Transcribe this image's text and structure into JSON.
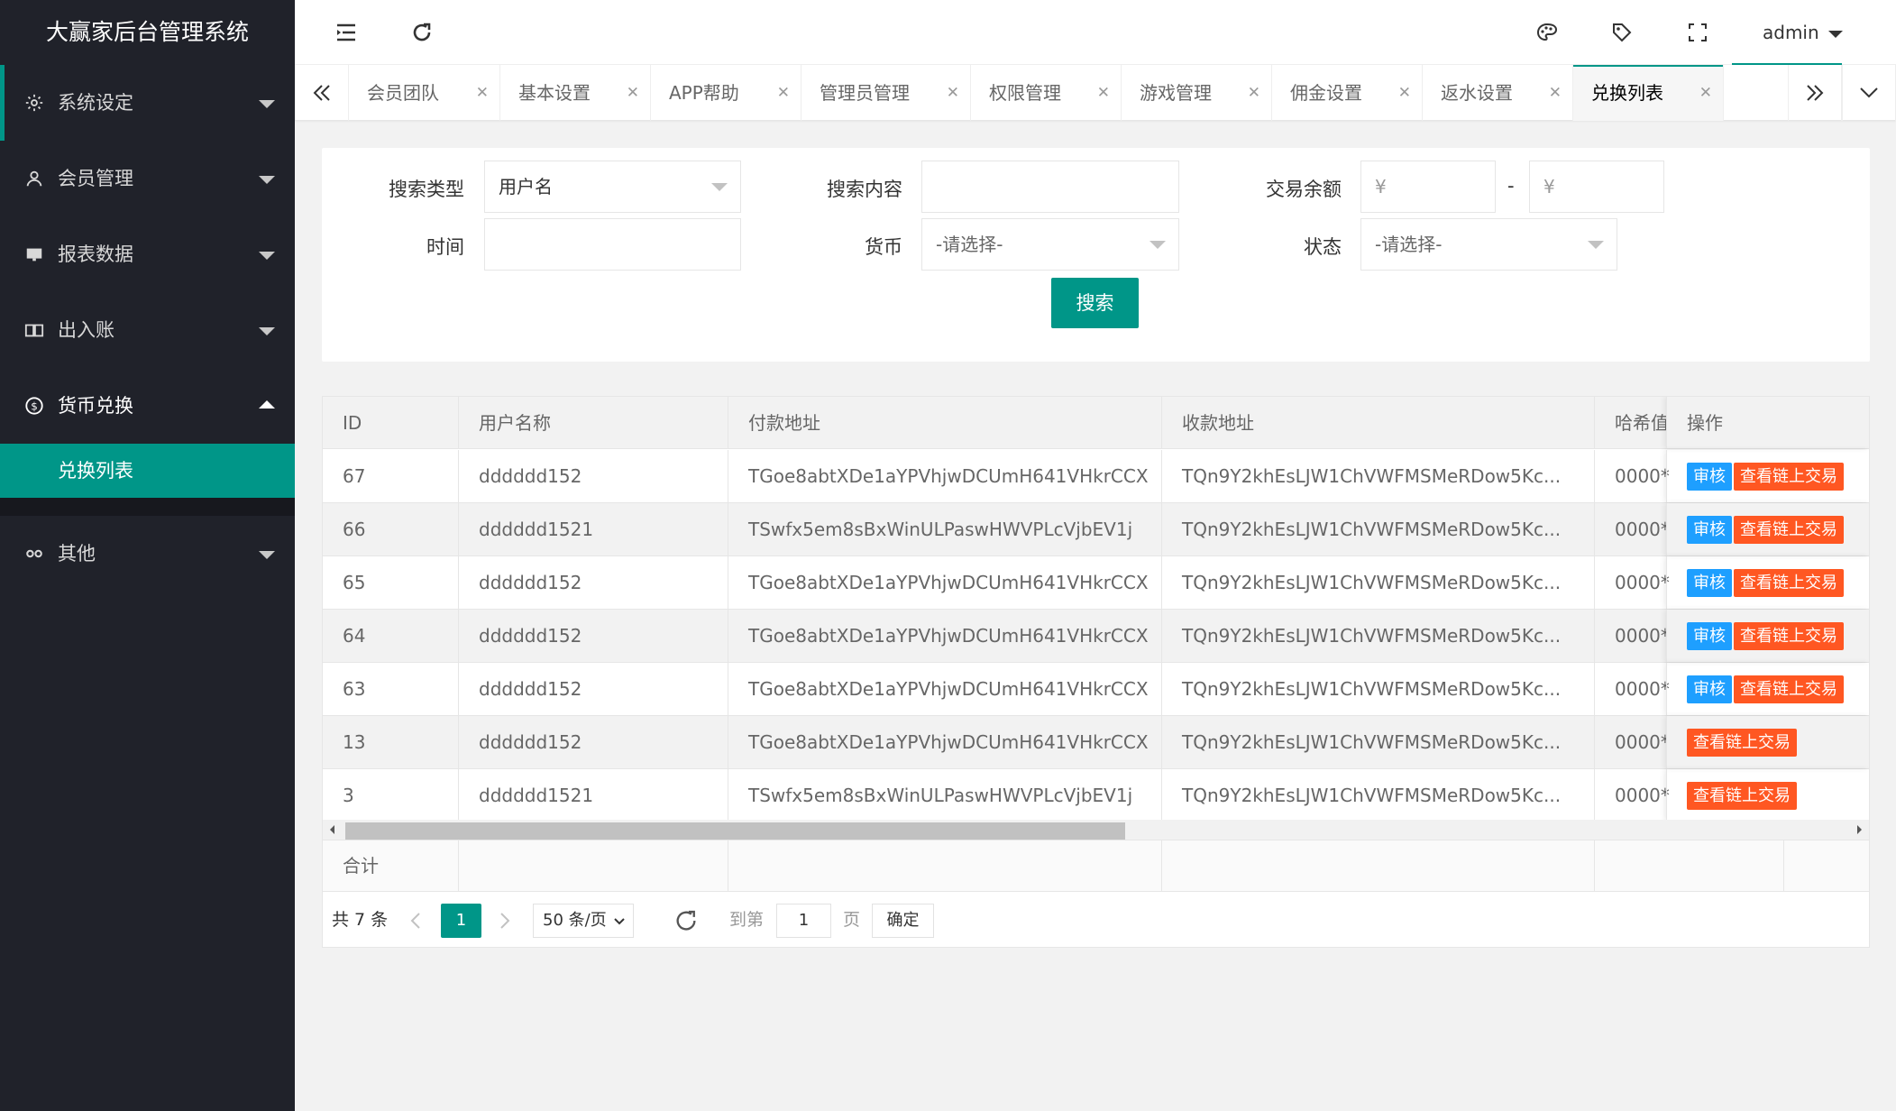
{
  "app": {
    "title": "大赢家后台管理系统"
  },
  "sidebar": {
    "items": [
      {
        "label": "系统设定"
      },
      {
        "label": "会员管理"
      },
      {
        "label": "报表数据"
      },
      {
        "label": "出入账"
      },
      {
        "label": "货币兑换"
      },
      {
        "label": "其他"
      }
    ],
    "sub_item": "兑换列表"
  },
  "header": {
    "user": "admin"
  },
  "tabs": [
    {
      "label": "会员团队"
    },
    {
      "label": "基本设置"
    },
    {
      "label": "APP帮助"
    },
    {
      "label": "管理员管理"
    },
    {
      "label": "权限管理"
    },
    {
      "label": "游戏管理"
    },
    {
      "label": "佣金设置"
    },
    {
      "label": "返水设置"
    },
    {
      "label": "兑换列表",
      "active": true
    }
  ],
  "search": {
    "type_label": "搜索类型",
    "type_value": "用户名",
    "content_label": "搜索内容",
    "content_value": "",
    "balance_label": "交易余额",
    "balance_min_placeholder": "¥",
    "balance_dash": "-",
    "balance_max_placeholder": "¥",
    "time_label": "时间",
    "time_value": "",
    "currency_label": "货币",
    "currency_placeholder": "-请选择-",
    "status_label": "状态",
    "status_placeholder": "-请选择-",
    "submit_label": "搜索"
  },
  "table": {
    "columns": [
      "ID",
      "用户名称",
      "付款地址",
      "收款地址",
      "哈希值",
      "操作"
    ],
    "rows": [
      {
        "id": "67",
        "user": "dddddd152",
        "pay": "TGoe8abtXDe1aYPVhjwDCUmH641VHkrCCX",
        "recv": "TQn9Y2khEsLJW1ChVWFMSMeRDow5Kc...",
        "hash": "0000*",
        "audit": true
      },
      {
        "id": "66",
        "user": "dddddd1521",
        "pay": "TSwfx5em8sBxWinULPaswHWVPLcVjbEV1j",
        "recv": "TQn9Y2khEsLJW1ChVWFMSMeRDow5Kc...",
        "hash": "0000*",
        "audit": true
      },
      {
        "id": "65",
        "user": "dddddd152",
        "pay": "TGoe8abtXDe1aYPVhjwDCUmH641VHkrCCX",
        "recv": "TQn9Y2khEsLJW1ChVWFMSMeRDow5Kc...",
        "hash": "0000*",
        "audit": true
      },
      {
        "id": "64",
        "user": "dddddd152",
        "pay": "TGoe8abtXDe1aYPVhjwDCUmH641VHkrCCX",
        "recv": "TQn9Y2khEsLJW1ChVWFMSMeRDow5Kc...",
        "hash": "0000*",
        "audit": true
      },
      {
        "id": "63",
        "user": "dddddd152",
        "pay": "TGoe8abtXDe1aYPVhjwDCUmH641VHkrCCX",
        "recv": "TQn9Y2khEsLJW1ChVWFMSMeRDow5Kc...",
        "hash": "0000*",
        "audit": true
      },
      {
        "id": "13",
        "user": "dddddd152",
        "pay": "TGoe8abtXDe1aYPVhjwDCUmH641VHkrCCX",
        "recv": "TQn9Y2khEsLJW1ChVWFMSMeRDow5Kc...",
        "hash": "0000*",
        "audit": false
      },
      {
        "id": "3",
        "user": "dddddd1521",
        "pay": "TSwfx5em8sBxWinULPaswHWVPLcVjbEV1j",
        "recv": "TQn9Y2khEsLJW1ChVWFMSMeRDow5Kc...",
        "hash": "0000*",
        "audit": false
      }
    ],
    "audit_label": "审核",
    "chain_label": "查看链上交易",
    "total_label": "合计"
  },
  "pager": {
    "total_text": "共 7 条",
    "current_page": "1",
    "page_size": "50 条/页",
    "goto_label": "到第",
    "goto_value": "1",
    "page_unit": "页",
    "confirm_label": "确定"
  },
  "colors": {
    "primary": "#009688",
    "blue": "#1e9fff",
    "orange": "#ff5722",
    "sidebar": "#20222a"
  }
}
